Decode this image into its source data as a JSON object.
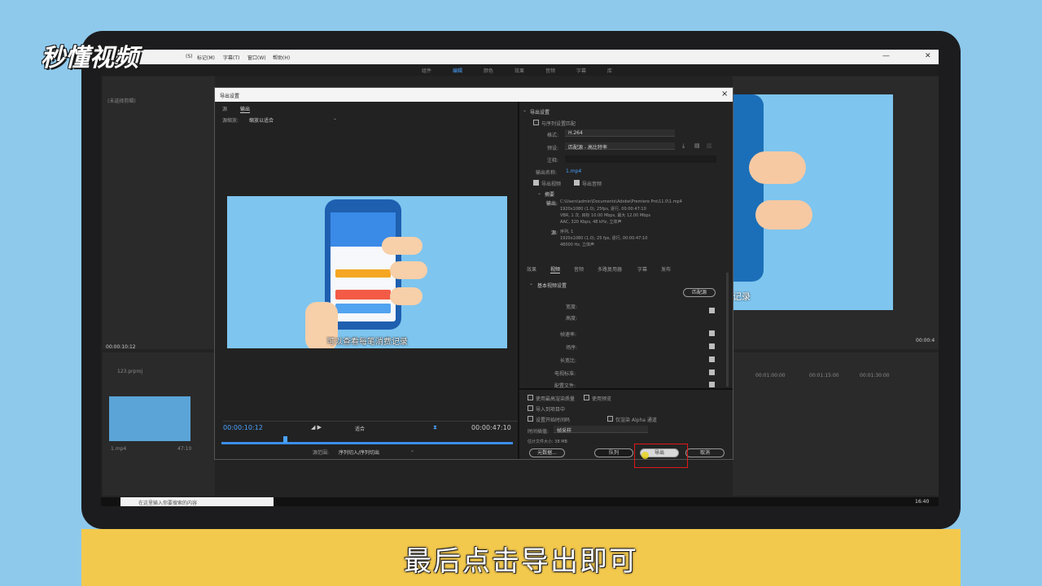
{
  "watermark": {
    "logo_text": "秒懂视频"
  },
  "caption": {
    "text": "最后点击导出即可"
  },
  "app": {
    "menu": [
      "(S)",
      "标记(M)",
      "字幕(T)",
      "窗口(W)",
      "帮助(H)"
    ],
    "workspaces": [
      "组件",
      "编辑",
      "颜色",
      "效果",
      "音频",
      "字幕",
      "库"
    ],
    "active_workspace": "编辑",
    "left_panel_label": "(未选择剪辑)",
    "timecode_left": "00:00:10:12",
    "project_file": "123.prproj",
    "clip_name": "1.mp4",
    "clip_duration": "47:10",
    "right_timecode": "00:00:4",
    "timeline_ticks": [
      "00:01:00:00",
      "00:01:15:00",
      "00:01:30:00"
    ],
    "program_subtitle": "记录",
    "clock": "16:40",
    "search_placeholder": "在这里输入你要搜索的内容"
  },
  "dialog": {
    "title": "导出设置",
    "close_glyph": "×",
    "tabs": [
      "源",
      "输出"
    ],
    "active_tab": "输出",
    "source_scaling_label": "源缩放:",
    "source_scaling_value": "缩放以适合",
    "preview_subtitle": "可以查看每笔消费记录",
    "timecode_in": "00:00:10:12",
    "timecode_out": "00:00:47:10",
    "fit_label": "适合",
    "source_range_label": "源范围:",
    "source_range_value": "序列切入/序列切出",
    "export_settings": {
      "header": "导出设置",
      "match_sequence": "与序列设置匹配",
      "format_label": "格式:",
      "format_value": "H.264",
      "preset_label": "预设:",
      "preset_value": "匹配源 - 高比特率",
      "comments_label": "注释:",
      "output_name_label": "输出名称:",
      "output_name_value": "1.mp4",
      "export_video": "导出视频",
      "export_audio": "导出音频",
      "summary_label": "摘要",
      "output_label": "输出:",
      "output_lines": [
        "C:\\Users\\admin\\Documents\\Adobe\\Premiere Pro\\11.0\\1.mp4",
        "1920x1080 (1.0), 25fps, 逐行, 00:00:47:10",
        "VBR, 1 次, 目标 10.00 Mbps, 最大 12.00 Mbps",
        "AAC, 320 Kbps, 48 kHz, 立体声"
      ],
      "source_label": "源:",
      "source_lines": [
        "序列, 1",
        "1920x1080 (1.0), 25 fps, 逐行, 00:00:47:10",
        "48000 Hz, 立体声"
      ]
    },
    "sub_tabs": [
      "效果",
      "视频",
      "音频",
      "多路复用器",
      "字幕",
      "发布"
    ],
    "active_sub_tab": "视频",
    "basic_video": {
      "header": "基本视频设置",
      "match_source_button": "匹配源",
      "fields": [
        "宽度:",
        "高度:",
        "帧速率:",
        "场序:",
        "长宽比:",
        "电视标准:",
        "配置文件:"
      ]
    },
    "options": {
      "max_render": "使用最高渲染质量",
      "use_previews": "使用预览",
      "import_project": "导入到项目中",
      "set_start_tc": "设置开始时间码",
      "alpha_only": "仅渲染 Alpha 通道",
      "time_interp_label": "时间插值:",
      "time_interp_value": "帧采样",
      "file_size": "估计文件大小: 38 MB"
    },
    "buttons": {
      "metadata": "元数据...",
      "queue": "队列",
      "export": "导出",
      "cancel": "取消"
    },
    "highlight_color": "#e01818"
  }
}
